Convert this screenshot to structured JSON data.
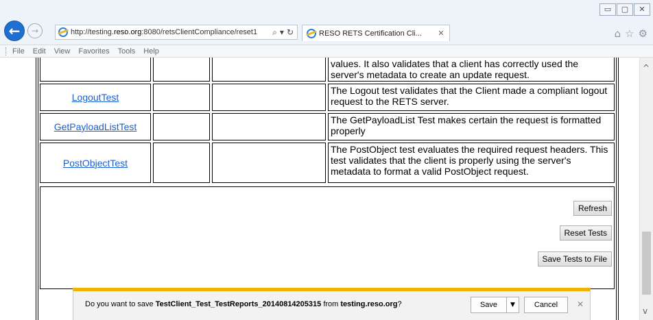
{
  "window": {
    "minimize_icon": "minimize-icon",
    "maximize_icon": "maximize-icon",
    "close_icon": "close-icon"
  },
  "browser": {
    "url_prefix": "http://testing.",
    "url_domain": "reso.org",
    "url_suffix": ":8080/retsClientCompliance/reset1",
    "tab_title": "RESO RETS Certification Cli...",
    "menu": [
      "File",
      "Edit",
      "View",
      "Favorites",
      "Tools",
      "Help"
    ]
  },
  "table": {
    "partial_row": {
      "description": "values. It also validates that a client has correctly used the server's metadata to create an update request."
    },
    "rows": [
      {
        "name": "LogoutTest",
        "description": "The Logout test validates that the Client made a compliant logout request to the RETS server."
      },
      {
        "name": "GetPayloadListTest",
        "description": "The GetPayloadList Test makes certain the request is formatted properly"
      },
      {
        "name": "PostObjectTest",
        "description": "The PostObject test evaluates the required request headers. This test validates that the client is properly using the server's metadata to format a valid PostObject request."
      }
    ]
  },
  "actions": {
    "refresh": "Refresh",
    "reset": "Reset Tests",
    "save_to_file": "Save Tests to File"
  },
  "download_bar": {
    "prefix": "Do you want to save ",
    "filename": "TestClient_Test_TestReports_20140814205315",
    "middle": " from ",
    "source": "testing.reso.org",
    "suffix": "?",
    "save": "Save",
    "cancel": "Cancel"
  }
}
